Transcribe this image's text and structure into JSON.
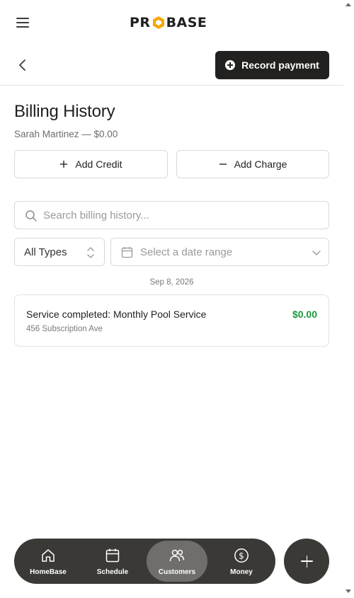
{
  "header": {
    "logo_text": "PROBASE",
    "logo_left": "PR",
    "logo_right": "BASE",
    "brand_color": "#f5a800"
  },
  "toolbar": {
    "record_payment_label": "Record payment"
  },
  "page": {
    "title": "Billing History",
    "subtitle": "Sarah Martinez — $0.00"
  },
  "actions": {
    "add_credit_label": "Add Credit",
    "add_charge_label": "Add Charge"
  },
  "search": {
    "placeholder": "Search billing history...",
    "value": ""
  },
  "filters": {
    "type_value": "All Types",
    "date_placeholder": "Select a date range"
  },
  "history": {
    "groups": [
      {
        "date": "Sep 8, 2026",
        "entries": [
          {
            "title": "Service completed: Monthly Pool Service",
            "address": "456 Subscription Ave",
            "amount": "$0.00",
            "amount_color": "#1a9a3c"
          }
        ]
      }
    ]
  },
  "bottom_nav": {
    "items": [
      {
        "label": "HomeBase",
        "icon": "home-icon",
        "active": false
      },
      {
        "label": "Schedule",
        "icon": "calendar-icon",
        "active": false
      },
      {
        "label": "Customers",
        "icon": "users-icon",
        "active": true
      },
      {
        "label": "Money",
        "icon": "dollar-icon",
        "active": false
      }
    ]
  },
  "fab": {
    "icon": "plus-icon"
  }
}
